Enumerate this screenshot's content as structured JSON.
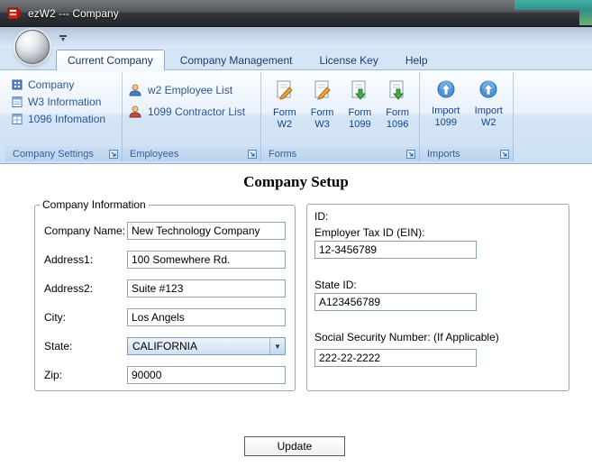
{
  "window": {
    "title": "ezW2 --- Company"
  },
  "ribbon": {
    "tabs": [
      {
        "label": "Current Company"
      },
      {
        "label": "Company Management"
      },
      {
        "label": "License Key"
      },
      {
        "label": "Help"
      }
    ],
    "groups": {
      "company_settings": {
        "label": "Company Settings",
        "items": [
          {
            "label": "Company"
          },
          {
            "label": "W3 Information"
          },
          {
            "label": "1096 Infomation"
          }
        ]
      },
      "employees": {
        "label": "Employees",
        "items": [
          {
            "label": "w2 Employee List"
          },
          {
            "label": "1099 Contractor List"
          }
        ]
      },
      "forms": {
        "label": "Forms",
        "items": [
          {
            "line1": "Form",
            "line2": "W2"
          },
          {
            "line1": "Form",
            "line2": "W3"
          },
          {
            "line1": "Form",
            "line2": "1099"
          },
          {
            "line1": "Form",
            "line2": "1096"
          }
        ]
      },
      "imports": {
        "label": "Imports",
        "items": [
          {
            "line1": "Import",
            "line2": "1099"
          },
          {
            "line1": "Import",
            "line2": "W2"
          }
        ]
      }
    }
  },
  "main": {
    "title": "Company Setup",
    "company_info": {
      "legend": "Company Information",
      "fields": [
        {
          "label": "Company Name:",
          "value": "New Technology Company"
        },
        {
          "label": "Address1:",
          "value": "100 Somewhere Rd."
        },
        {
          "label": "Address2:",
          "value": "Suite #123"
        },
        {
          "label": "City:",
          "value": "Los Angels"
        },
        {
          "label": "State:",
          "value": "CALIFORNIA"
        },
        {
          "label": "Zip:",
          "value": "90000"
        }
      ]
    },
    "ids": {
      "heading": "ID:",
      "fields": [
        {
          "label": "Employer Tax ID (EIN):",
          "value": "12-3456789"
        },
        {
          "label": "State ID:",
          "value": "A123456789"
        },
        {
          "label": "Social Security Number: (If Applicable)",
          "value": "222-22-2222"
        }
      ]
    },
    "update_button": "Update"
  }
}
